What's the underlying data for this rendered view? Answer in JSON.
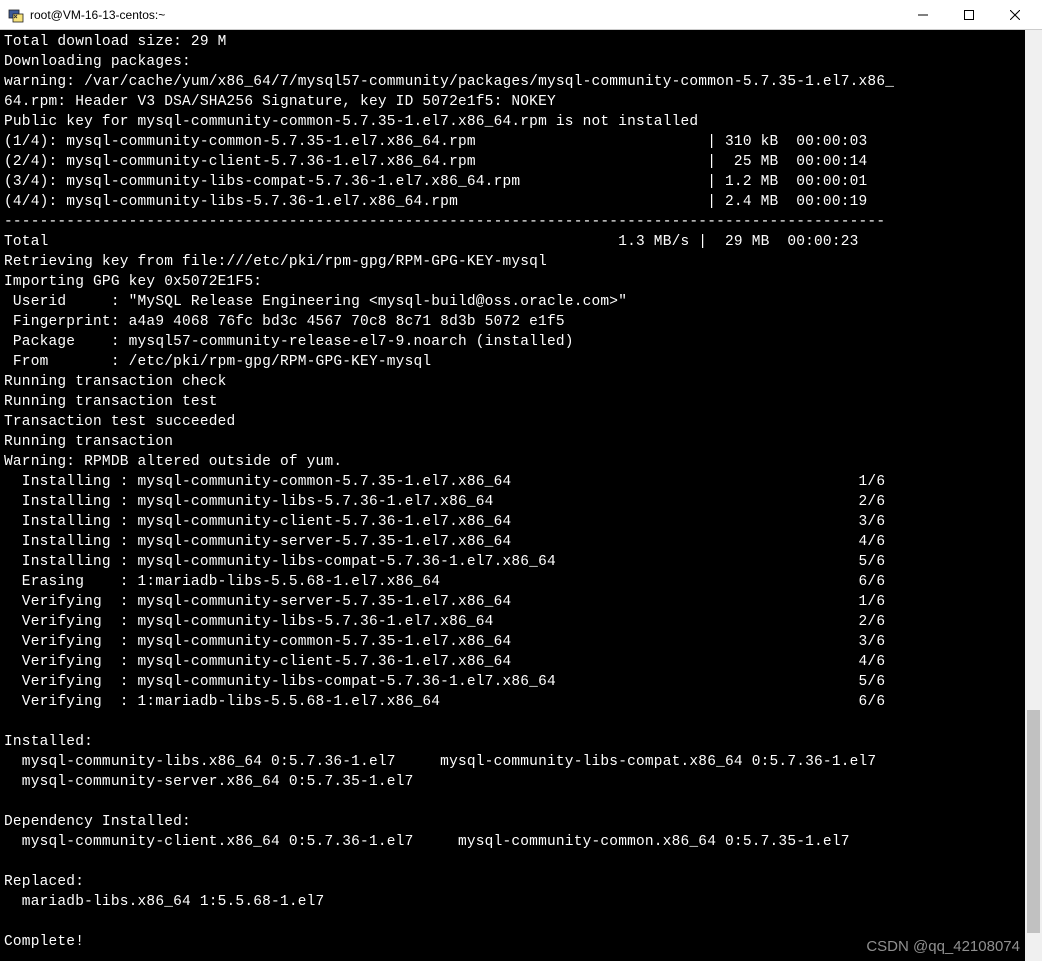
{
  "window": {
    "title": "root@VM-16-13-centos:~"
  },
  "terminal": {
    "lines": [
      "Total download size: 29 M",
      "Downloading packages:",
      "warning: /var/cache/yum/x86_64/7/mysql57-community/packages/mysql-community-common-5.7.35-1.el7.x86_",
      "64.rpm: Header V3 DSA/SHA256 Signature, key ID 5072e1f5: NOKEY",
      "Public key for mysql-community-common-5.7.35-1.el7.x86_64.rpm is not installed",
      "(1/4): mysql-community-common-5.7.35-1.el7.x86_64.rpm                          | 310 kB  00:00:03",
      "(2/4): mysql-community-client-5.7.36-1.el7.x86_64.rpm                          |  25 MB  00:00:14",
      "(3/4): mysql-community-libs-compat-5.7.36-1.el7.x86_64.rpm                     | 1.2 MB  00:00:01",
      "(4/4): mysql-community-libs-5.7.36-1.el7.x86_64.rpm                            | 2.4 MB  00:00:19",
      "---------------------------------------------------------------------------------------------------",
      "Total                                                                1.3 MB/s |  29 MB  00:00:23",
      "Retrieving key from file:///etc/pki/rpm-gpg/RPM-GPG-KEY-mysql",
      "Importing GPG key 0x5072E1F5:",
      " Userid     : \"MySQL Release Engineering <mysql-build@oss.oracle.com>\"",
      " Fingerprint: a4a9 4068 76fc bd3c 4567 70c8 8c71 8d3b 5072 e1f5",
      " Package    : mysql57-community-release-el7-9.noarch (installed)",
      " From       : /etc/pki/rpm-gpg/RPM-GPG-KEY-mysql",
      "Running transaction check",
      "Running transaction test",
      "Transaction test succeeded",
      "Running transaction",
      "Warning: RPMDB altered outside of yum.",
      "  Installing : mysql-community-common-5.7.35-1.el7.x86_64                                       1/6",
      "  Installing : mysql-community-libs-5.7.36-1.el7.x86_64                                         2/6",
      "  Installing : mysql-community-client-5.7.36-1.el7.x86_64                                       3/6",
      "  Installing : mysql-community-server-5.7.35-1.el7.x86_64                                       4/6",
      "  Installing : mysql-community-libs-compat-5.7.36-1.el7.x86_64                                  5/6",
      "  Erasing    : 1:mariadb-libs-5.5.68-1.el7.x86_64                                               6/6",
      "  Verifying  : mysql-community-server-5.7.35-1.el7.x86_64                                       1/6",
      "  Verifying  : mysql-community-libs-5.7.36-1.el7.x86_64                                         2/6",
      "  Verifying  : mysql-community-common-5.7.35-1.el7.x86_64                                       3/6",
      "  Verifying  : mysql-community-client-5.7.36-1.el7.x86_64                                       4/6",
      "  Verifying  : mysql-community-libs-compat-5.7.36-1.el7.x86_64                                  5/6",
      "  Verifying  : 1:mariadb-libs-5.5.68-1.el7.x86_64                                               6/6",
      "",
      "Installed:",
      "  mysql-community-libs.x86_64 0:5.7.36-1.el7     mysql-community-libs-compat.x86_64 0:5.7.36-1.el7",
      "  mysql-community-server.x86_64 0:5.7.35-1.el7",
      "",
      "Dependency Installed:",
      "  mysql-community-client.x86_64 0:5.7.36-1.el7     mysql-community-common.x86_64 0:5.7.35-1.el7",
      "",
      "Replaced:",
      "  mariadb-libs.x86_64 1:5.5.68-1.el7",
      "",
      "Complete!"
    ]
  },
  "watermark": "CSDN @qq_42108074",
  "scrollbar": {
    "thumb_top_pct": 73,
    "thumb_height_pct": 24
  }
}
